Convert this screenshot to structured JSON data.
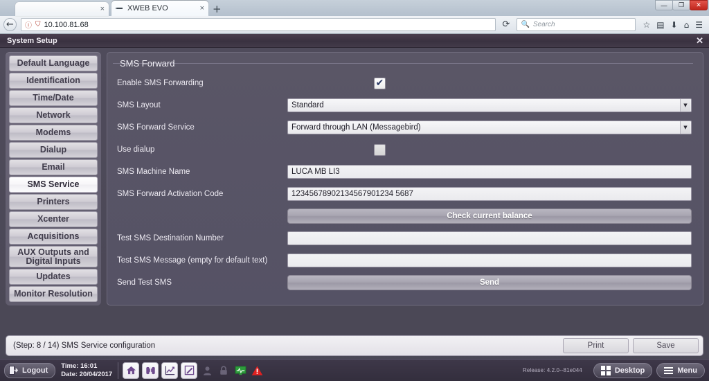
{
  "browser": {
    "tabs": [
      {
        "title": "",
        "favicon": "blank-page-icon",
        "close_label": "×"
      },
      {
        "title": "XWEB EVO",
        "favicon": "xweb-icon",
        "close_label": "×"
      }
    ],
    "new_tab_label": "+",
    "window_controls": {
      "minimize": "—",
      "maximize": "❐",
      "close": "✕"
    },
    "back_label": "←",
    "reload_label": "⟳",
    "url": "10.100.81.68",
    "identity_icon": "info-circle-icon",
    "tracking_icon": "shield-crossed-icon",
    "search_placeholder": "Search",
    "search_icon": "search-icon",
    "nav_icons": [
      "bookmark-star-icon",
      "library-icon",
      "downloads-icon",
      "home-icon",
      "menu-hamburger-icon"
    ]
  },
  "window": {
    "title": "System Setup",
    "close_label": "✕"
  },
  "sidebar": {
    "items": [
      {
        "label": "Default Language",
        "active": false
      },
      {
        "label": "Identification",
        "active": false
      },
      {
        "label": "Time/Date",
        "active": false
      },
      {
        "label": "Network",
        "active": false
      },
      {
        "label": "Modems",
        "active": false
      },
      {
        "label": "Dialup",
        "active": false
      },
      {
        "label": "Email",
        "active": false
      },
      {
        "label": "SMS Service",
        "active": true
      },
      {
        "label": "Printers",
        "active": false
      },
      {
        "label": "Xcenter",
        "active": false
      },
      {
        "label": "Acquisitions",
        "active": false
      },
      {
        "label": "AUX Outputs and",
        "label2": "Digital Inputs",
        "active": false
      },
      {
        "label": "Updates",
        "active": false
      },
      {
        "label": "Monitor Resolution",
        "active": false
      }
    ]
  },
  "panel": {
    "fieldset_title": "SMS Forward",
    "fields": {
      "enable_label": "Enable SMS Forwarding",
      "enable_checked": true,
      "layout_label": "SMS Layout",
      "layout_value": "Standard",
      "service_label": "SMS Forward Service",
      "service_value": "Forward through LAN (Messagebird)",
      "dialup_label": "Use dialup",
      "dialup_checked": false,
      "machine_label": "SMS Machine Name",
      "machine_value": "LUCA MB LI3",
      "activation_label": "SMS Forward Activation Code",
      "activation_value": "12345678902134567901234 5687",
      "check_balance_label": "Check current balance",
      "test_dest_label": "Test SMS Destination Number",
      "test_dest_value": "",
      "test_msg_label": "Test SMS Message (empty for default text)",
      "test_msg_value": "",
      "send_test_label": "Send Test SMS",
      "send_button_label": "Send"
    }
  },
  "statusbar": {
    "text": "(Step: 8 / 14) SMS Service configuration",
    "print_label": "Print",
    "save_label": "Save"
  },
  "taskbar": {
    "logout_label": "Logout",
    "logout_icon": "logout-door-icon",
    "time_line": "Time: 16:01",
    "date_line": "Date: 20/04/2017",
    "tray_icons": [
      "home-icon",
      "binoculars-icon",
      "chart-icon",
      "edit-note-icon",
      "user-icon",
      "lock-icon",
      "monitor-pulse-icon",
      "warning-triangle-icon"
    ],
    "release": "Release: 4.2.0--81e044",
    "desktop_label": "Desktop",
    "desktop_icon": "grid-squares-icon",
    "menu_label": "Menu",
    "menu_icon": "hamburger-icon"
  },
  "colors": {
    "panel_bg": "#575365",
    "accent_purple": "#6f4b8e",
    "title_bar": "#3a3241",
    "warning_red": "#e02020",
    "ok_green": "#2e9c3c"
  }
}
